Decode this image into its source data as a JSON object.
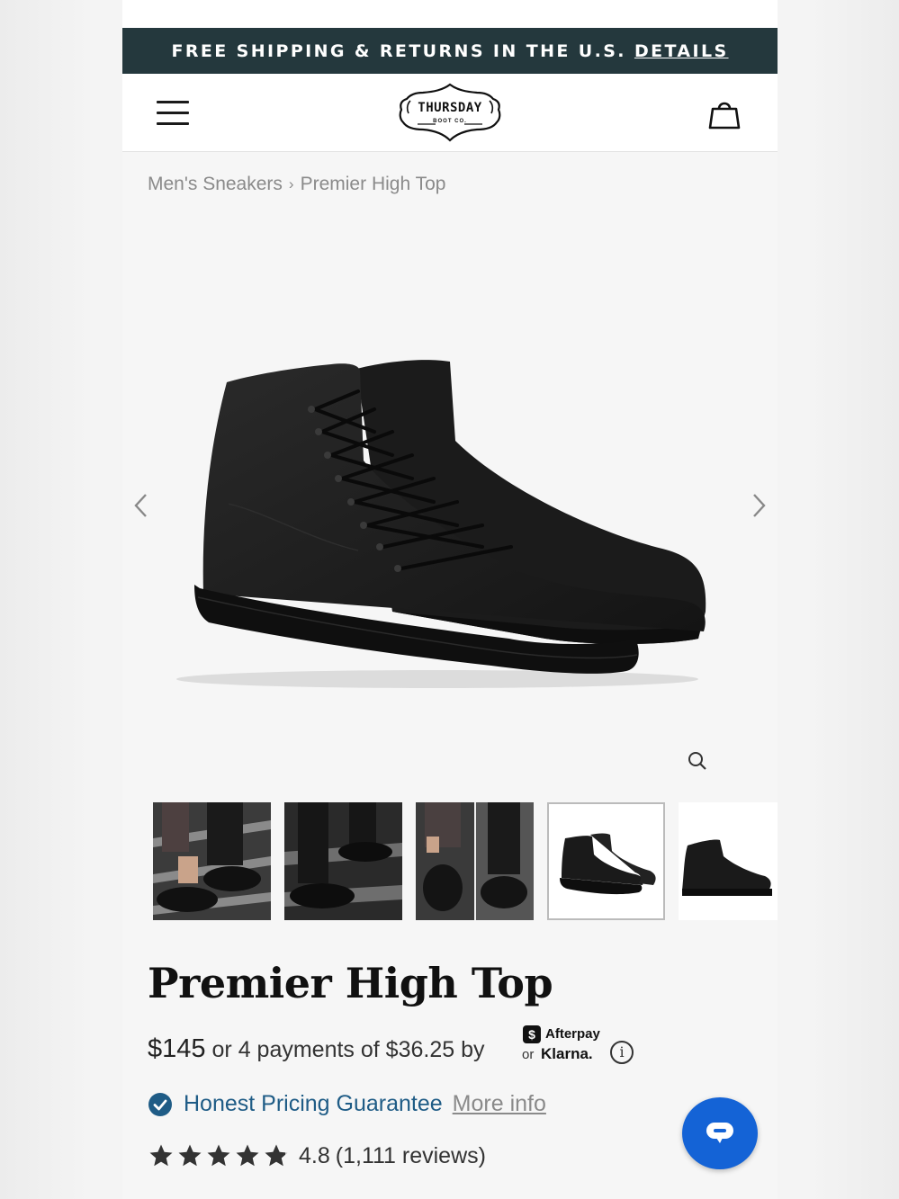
{
  "banner": {
    "text": "FREE SHIPPING & RETURNS IN THE U.S.",
    "link": "DETAILS"
  },
  "header": {
    "logo_name": "THURSDAY",
    "logo_sub": "BOOT CO."
  },
  "breadcrumb": {
    "items": [
      "Men's Sneakers",
      "Premier High Top"
    ],
    "separator": "›"
  },
  "product": {
    "title": "Premier High Top",
    "price": "$145",
    "installment_text": "or 4 payments of $36.25 by",
    "afterpay_badge": "$",
    "afterpay_label": "Afterpay",
    "or_label": "or",
    "klarna_label": "Klarna.",
    "info_glyph": "i",
    "guarantee": "Honest Pricing Guarantee",
    "more_info": "More info",
    "rating_value": "4.8",
    "rating_count": "(1,111 reviews)",
    "stars": 4.8
  },
  "gallery": {
    "thumbnails": [
      "lifestyle-lacing",
      "lifestyle-stairs",
      "lifestyle-split",
      "product-pair",
      "product-side"
    ],
    "selected_index": 3
  },
  "colors": {
    "banner_bg": "#24383d",
    "guarantee_blue": "#1f5c86",
    "chat_blue": "#1463d6",
    "check_blue": "#1f5c86"
  }
}
